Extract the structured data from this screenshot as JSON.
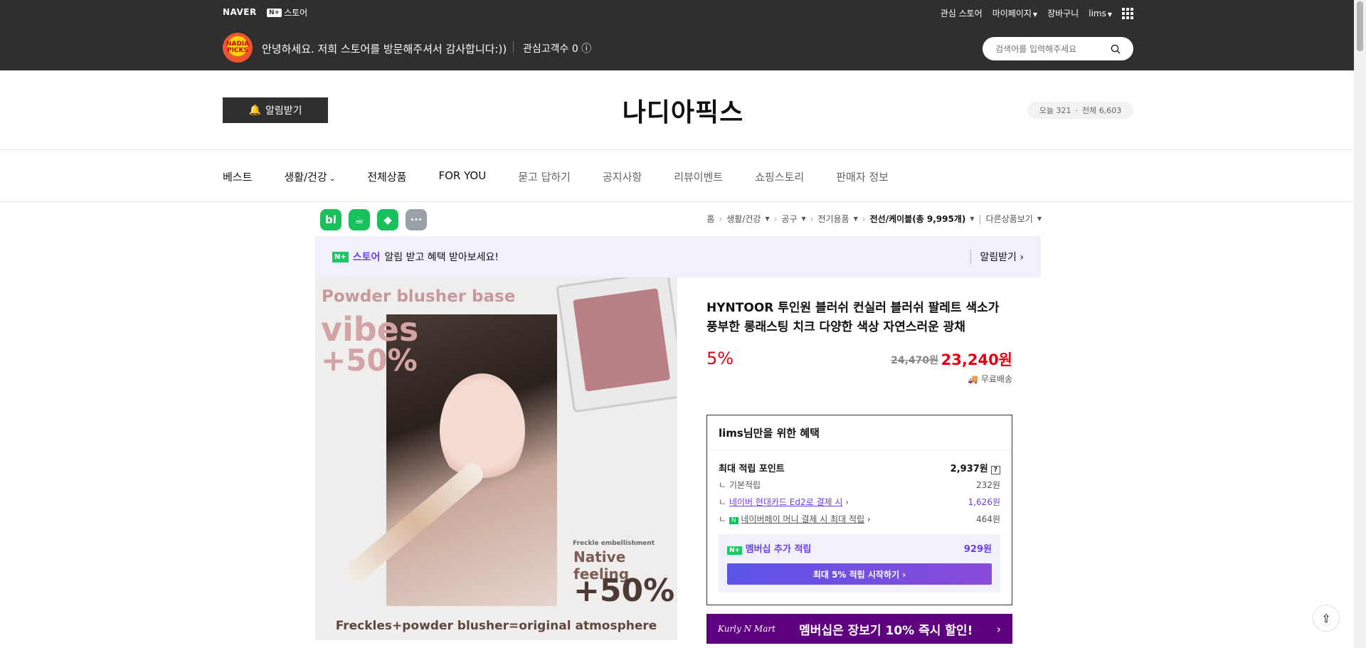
{
  "topbar": {
    "naver": "NAVER",
    "nplus_badge": "N+",
    "nplus_label": "스토어",
    "links": [
      "관심 스토어",
      "마이페이지",
      "장바구니",
      "lims"
    ],
    "greeting": "안녕하세요. 저희 스토어를 방문해주셔서 감사합니다:))",
    "fav_customers": "관심고객수 0",
    "search_placeholder": "검색어를 입력해주세요",
    "avatar_text": "NADIA PICKS"
  },
  "store": {
    "alert_button": "알림받기",
    "title": "나디아픽스",
    "today": "오늘 321",
    "total": "전체 6,603"
  },
  "nav": {
    "items": [
      "베스트",
      "생활/건강",
      "전체상품",
      "FOR YOU",
      "묻고 답하기",
      "공지사항",
      "리뷰이벤트",
      "쇼핑스토리",
      "판매자 정보"
    ]
  },
  "sns": [
    "bl",
    "☕",
    "◆",
    "···"
  ],
  "breadcrumbs": {
    "items": [
      "홈",
      "생활/건강",
      "공구",
      "전기용품",
      "전선/케이블(총 9,995개)",
      "다른상품보기"
    ]
  },
  "promo": {
    "badge": "N+",
    "store": "스토어",
    "text": "알림 받고 혜택 받아보세요!",
    "action": "알림받기"
  },
  "product_image": {
    "t1": "Powder blusher base",
    "t2": "vibes",
    "t3": "+50%",
    "small": "Freckle embellishment",
    "nf": "Native feeling",
    "p50": "+50%",
    "bottom": "Freckles+powder blusher=original atmosphere"
  },
  "product": {
    "title": "HYNTOOR 투인원 블러쉬 컨실러 블러쉬 팔레트 색소가 풍부한 롱래스팅 치크 다양한 색상 자연스러운 광채",
    "discount": "5%",
    "original_price": "24,470원",
    "sale_price": "23,240원",
    "shipping": "무료배송"
  },
  "benefit": {
    "header": "lims님만을 위한 혜택",
    "max_point_label": "최대 적립 포인트",
    "max_point_value": "2,937원",
    "q": "?",
    "rows": [
      {
        "label": "기본적립",
        "value": "232원"
      },
      {
        "label": "네이버 현대카드 Ed2로 결제 시",
        "value": "1,626원"
      },
      {
        "label": "네이버페이 머니 결제 시 최대 적립",
        "value": "464원"
      }
    ],
    "member_label": "멤버십 추가 적립",
    "member_value": "929원",
    "member_cta": "최대 5% 적립 시작하기 ›"
  },
  "kurly": {
    "logo": "Kurly N Mart",
    "text": "멤버십은 장보기 10% 즉시 할인!"
  }
}
